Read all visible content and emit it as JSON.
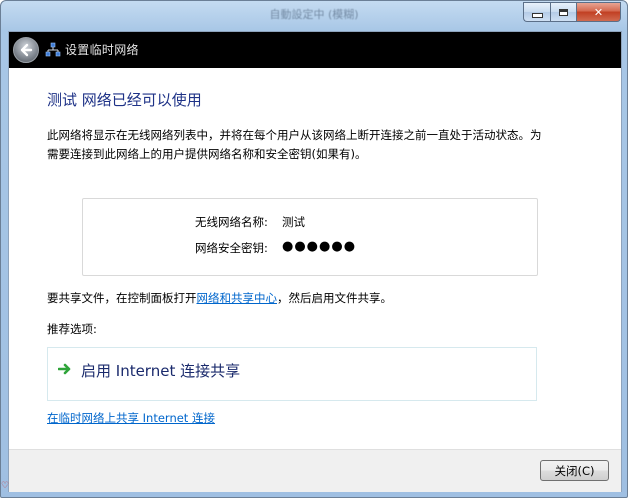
{
  "window": {
    "title": "自動設定中 (模糊)",
    "controls": {
      "minimize": "",
      "maximize": "",
      "close": "✕"
    }
  },
  "nav": {
    "title": "设置临时网络",
    "back_icon": "back-arrow-icon",
    "network_icon": "network-icon"
  },
  "main": {
    "heading": "测试 网络已经可以使用",
    "description": "此网络将显示在无线网络列表中，并将在每个用户从该网络上断开连接之前一直处于活动状态。为需要连接到此网络上的用户提供网络名称和安全密钥(如果有)。",
    "info": {
      "name_label": "无线网络名称:",
      "name_value": "测试",
      "key_label": "网络安全密钥:",
      "key_value": "●●●●●●"
    },
    "share_prefix": "要共享文件，在控制面板打开",
    "share_link": "网络和共享中心",
    "share_suffix": "，然后启用文件共享。",
    "recommended_label": "推荐选项:",
    "option_label": "启用 Internet 连接共享",
    "bottom_link": "在临时网络上共享 Internet 连接"
  },
  "footer": {
    "close_label": "关闭(C)"
  },
  "colors": {
    "heading": "#1e3287",
    "link": "#0066cc",
    "arrow_green": "#2fa43a"
  }
}
